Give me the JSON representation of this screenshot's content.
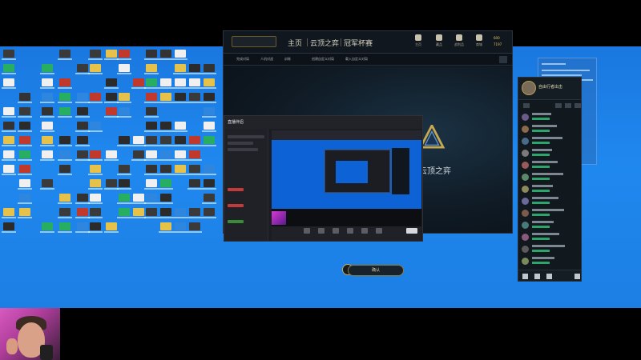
{
  "game_client": {
    "nav": [
      "主页",
      "云顶之弈",
      "冠军杯赛"
    ],
    "top_icons": [
      "主页",
      "藏品",
      "战利品",
      "商城"
    ],
    "currency": [
      "600",
      "7197"
    ],
    "subtabs": [
      "完成对局",
      "人机对战",
      "训练",
      "创建自定义对局",
      "载入自定义对局"
    ],
    "mode_title": "云顶之弈",
    "confirm_label": "确认"
  },
  "stream_app": {
    "title": "直播伴侣"
  },
  "social": {
    "my_name": "自由行者出击"
  },
  "colors": {
    "desktop": "#1c7fe4",
    "client_gold": "#c5a850",
    "online_green": "#2da46a",
    "webcam_bg": "#d85ac0"
  }
}
